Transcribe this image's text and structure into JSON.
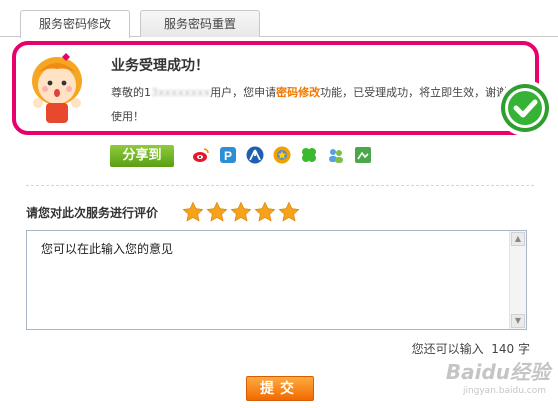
{
  "tabs": [
    {
      "label": "服务密码修改",
      "active": true
    },
    {
      "label": "服务密码重置",
      "active": false
    }
  ],
  "result": {
    "title": "业务受理成功！",
    "msg_prefix": "尊敬的1",
    "msg_masked": "3xxxxxxxx",
    "msg_user": "用户，您申请",
    "msg_highlight": "密码修改",
    "msg_suffix": "功能，已受理成功，将立即生效，谢谢使用！",
    "highlight_color": "#f07800",
    "border_color": "#e8006c"
  },
  "share": {
    "label": "分享到",
    "icons": [
      "sina-weibo-icon",
      "qzone-icon",
      "renren-icon",
      "kaixin-icon",
      "clover-icon",
      "friends-icon",
      "share-map-icon"
    ]
  },
  "rating": {
    "label": "请您对此次服务进行评价",
    "stars": 5,
    "max": 5
  },
  "comment": {
    "placeholder": "您可以在此输入您的意见"
  },
  "counter": {
    "prefix": "您还可以输入",
    "remaining": "140",
    "unit": "字"
  },
  "submit": {
    "label": "提交"
  },
  "watermark": {
    "main": "Baidu经验",
    "sub": "jingyan.baidu.com"
  }
}
